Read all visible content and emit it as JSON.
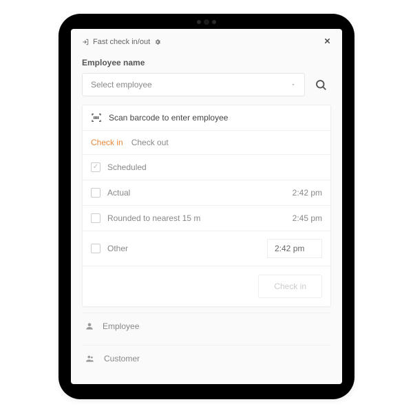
{
  "header": {
    "title": "Fast check in/out"
  },
  "form": {
    "employee_label": "Employee name",
    "employee_placeholder": "Select employee",
    "scan_text": "Scan barcode to enter employee"
  },
  "tabs": {
    "checkin": "Check in",
    "checkout": "Check out"
  },
  "options": {
    "scheduled": {
      "label": "Scheduled"
    },
    "actual": {
      "label": "Actual",
      "time": "2:42 pm"
    },
    "rounded": {
      "label": "Rounded to nearest 15 m",
      "time": "2:45 pm"
    },
    "other": {
      "label": "Other",
      "time": "2:42 pm"
    }
  },
  "actions": {
    "checkin": "Check in"
  },
  "footer": {
    "employee": "Employee",
    "customer": "Customer"
  },
  "colors": {
    "accent": "#e98a3c"
  }
}
